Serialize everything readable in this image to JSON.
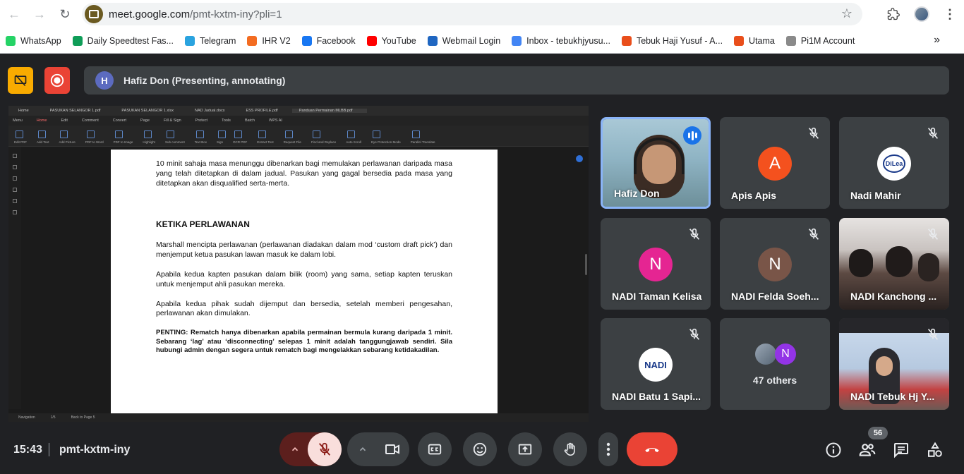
{
  "browser": {
    "url_host": "meet.google.com",
    "url_path": "/pmt-kxtm-iny?pli=1"
  },
  "bookmarks": [
    {
      "label": "WhatsApp",
      "color": "#25d366"
    },
    {
      "label": "Daily Speedtest Fas...",
      "color": "#0f9d58"
    },
    {
      "label": "Telegram",
      "color": "#2aa3df"
    },
    {
      "label": "IHR V2",
      "color": "#f36c21"
    },
    {
      "label": "Facebook",
      "color": "#1877f2"
    },
    {
      "label": "YouTube",
      "color": "#ff0000"
    },
    {
      "label": "Webmail Login",
      "color": "#1f66c1"
    },
    {
      "label": "Inbox - tebukhjyusu...",
      "color": "#4285f4"
    },
    {
      "label": "Tebuk Haji Yusuf - A...",
      "color": "#e94e1b"
    },
    {
      "label": "Utama",
      "color": "#e94e1b"
    },
    {
      "label": "Pi1M Account",
      "color": "#8a8a8a"
    }
  ],
  "meet": {
    "presenter_initial": "H",
    "presenter_text": "Hafiz Don (Presenting, annotating)",
    "time": "15:43",
    "meeting_code": "pmt-kxtm-iny",
    "participant_count": "56"
  },
  "screen_share": {
    "tabs": [
      "Home",
      "PASUKAN SELANGOR 1.pdf",
      "PASUKAN SELANGOR 1.xlsx",
      "NAD Jadual.docx",
      "ESS PROFILE.pdf",
      "Panduan Permainan MLBB.pdf"
    ],
    "menu": [
      "Menu",
      "Home",
      "Edit",
      "Comment",
      "Convert",
      "Page",
      "Fill & Sign",
      "Protect",
      "Tools",
      "Batch",
      "WPS AI"
    ],
    "ribbon": [
      "Edit PDF",
      "Add Text",
      "Add Picture",
      "PDF to Word",
      "PDF to Image",
      "Highlight",
      "Sub comment",
      "Text Box",
      "Sign",
      "OCR PDF",
      "Extract Text",
      "Request File",
      "Find and Replace",
      "Auto Scroll",
      "Eye Protection Mode",
      "Parallel Translate"
    ],
    "status": [
      "Navigation",
      "1/5",
      "Back to Page 5"
    ],
    "paragraphs": [
      "10 minit sahaja masa menunggu dibenarkan bagi memulakan perlawanan daripada masa yang telah ditetapkan di dalam jadual. Pasukan yang gagal bersedia pada masa yang ditetapkan akan disqualified serta-merta.",
      "KETIKA PERLAWANAN",
      "Marshall mencipta perlawanan (perlawanan diadakan  dalam mod ‘custom draft pick’) dan menjemput ketua pasukan lawan masuk ke dalam lobi.",
      "Apabila kedua kapten pasukan dalam bilik (room) yang sama, setiap kapten teruskan untuk menjemput ahli pasukan mereka.",
      "Apabila kedua pihak sudah dijemput dan bersedia, setelah memberi pengesahan, perlawanan akan dimulakan.",
      "PENTING: Rematch hanya dibenarkan apabila permainan bermula kurang daripada  1 minit. Sebarang ‘lag’ atau ‘disconnecting’ selepas 1 minit adalah  tanggungjawab sendiri. Sila hubungi  admin  dengan  segera  untuk  rematch  bagi   mengelakkan  sebarang ketidakadilan."
    ]
  },
  "participants": [
    {
      "name": "Hafiz Don",
      "type": "video",
      "speaking": true
    },
    {
      "name": "Apis Apis",
      "type": "avatar",
      "initial": "A",
      "color": "#f4511e"
    },
    {
      "name": "Nadi Mahir",
      "type": "logo",
      "logo_text": "DiLea"
    },
    {
      "name": "NADI Taman Kelisa",
      "type": "avatar",
      "initial": "N",
      "color": "#e52592"
    },
    {
      "name": "NADI Felda Soeh...",
      "type": "avatar",
      "initial": "N",
      "color": "#795548"
    },
    {
      "name": "NADI Kanchong ...",
      "type": "photo"
    },
    {
      "name": "NADI Batu 1 Sapi...",
      "type": "logo",
      "logo_text": "NADI"
    },
    {
      "name": "47 others",
      "type": "others",
      "initial": "N",
      "color": "#9334e6"
    },
    {
      "name": "NADI Tebuk Hj Y...",
      "type": "photo"
    }
  ],
  "colors": {
    "background": "#202124",
    "tile": "#3c4043",
    "active_border": "#8ab4f8",
    "end_call": "#ea4335",
    "mic_off_bg": "#f9dedc",
    "record": "#ea4335",
    "present_badge": "#f9ab00"
  }
}
